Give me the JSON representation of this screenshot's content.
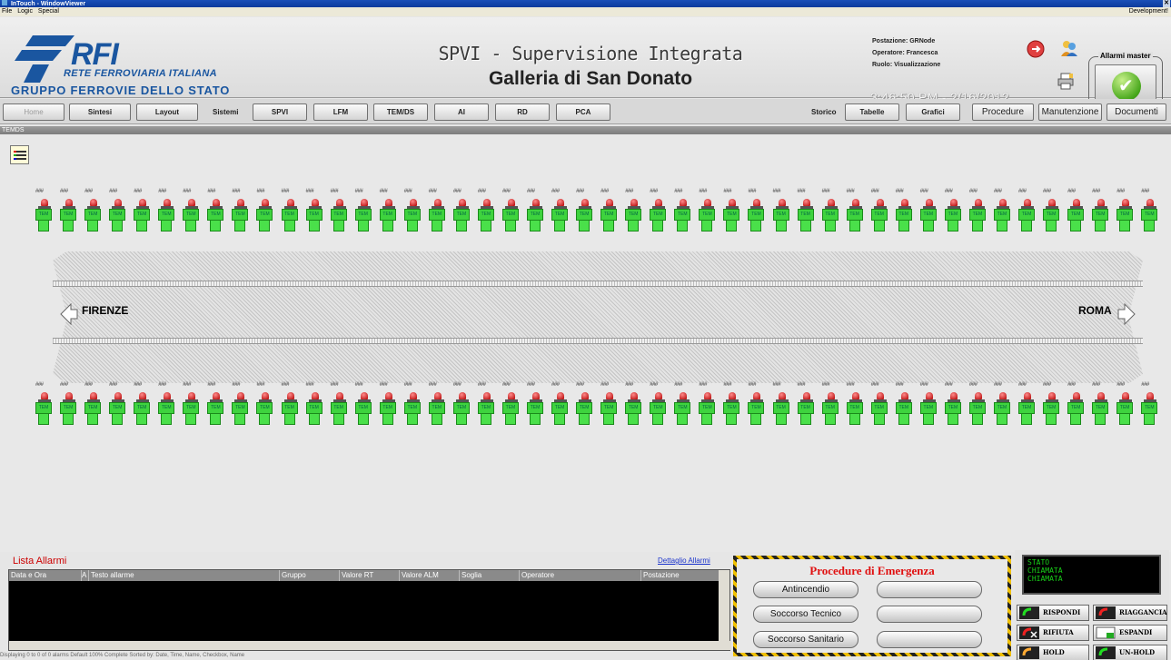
{
  "window": {
    "title": "InTouch - WindowViewer",
    "menu": [
      "File",
      "Logic",
      "Special"
    ],
    "right_label": "Development!"
  },
  "header": {
    "logo_main": "RFI",
    "logo_sub": "RETE FERROVIARIA ITALIANA",
    "logo_group": "GRUPPO FERROVIE DELLO STATO",
    "title": "SPVI - Supervisione Integrata",
    "subtitle": "Galleria di San Donato",
    "postazione": "Postazione: GRNode",
    "operatore": "Operatore: Francesca",
    "ruolo": "Ruolo: Visualizzazione",
    "clock": "3:46:50 PM - 2/16/2012",
    "alarm_master_label": "Allarmi master"
  },
  "nav": {
    "home": "Home",
    "sintesi": "Sintesi",
    "layout": "Layout",
    "sistemi_label": "Sistemi",
    "sistemi": [
      "SPVI",
      "LFM",
      "TEM/DS",
      "AI",
      "RD",
      "PCA"
    ],
    "storico_label": "Storico",
    "storico": [
      "Tabelle",
      "Grafici"
    ],
    "right": [
      "Procedure",
      "Manutenzione",
      "Documenti"
    ]
  },
  "section_title": "TEMDS",
  "tunnel": {
    "left_dir": "FIRENZE",
    "right_dir": "ROMA",
    "unit_label": "TEM",
    "unit_hash": "###",
    "units_per_row": 46
  },
  "alarms": {
    "title": "Lista Allarmi",
    "detail_link": "Dettaglio Allarmi",
    "columns": [
      "Data e Ora",
      "Testo allarme",
      "Gruppo",
      "Valore RT",
      "Valore ALM",
      "Soglia",
      "Operatore",
      "Postazione"
    ],
    "sort_indicator": "A",
    "status": "Displaying 0 to 0 of 0 alarms   Default   100% Complete   Sorted by: Date, Time, Name, Checkbox, Name"
  },
  "procedures": {
    "title": "Procedure di Emergenza",
    "buttons": [
      "Antincendio",
      "",
      "Soccorso Tecnico",
      "",
      "Soccorso Sanitario",
      ""
    ]
  },
  "phone": {
    "lcd": [
      "STATO",
      "CHIAMATA",
      "CHIAMATA"
    ],
    "buttons": [
      "RISPONDI",
      "RIAGGANCIA",
      "RIFIUTA",
      "ESPANDI",
      "HOLD",
      "UN-HOLD"
    ]
  },
  "colors": {
    "accent_blue": "#1a56a0",
    "alarm_red": "#c00000",
    "tem_green": "#3ed33e"
  }
}
